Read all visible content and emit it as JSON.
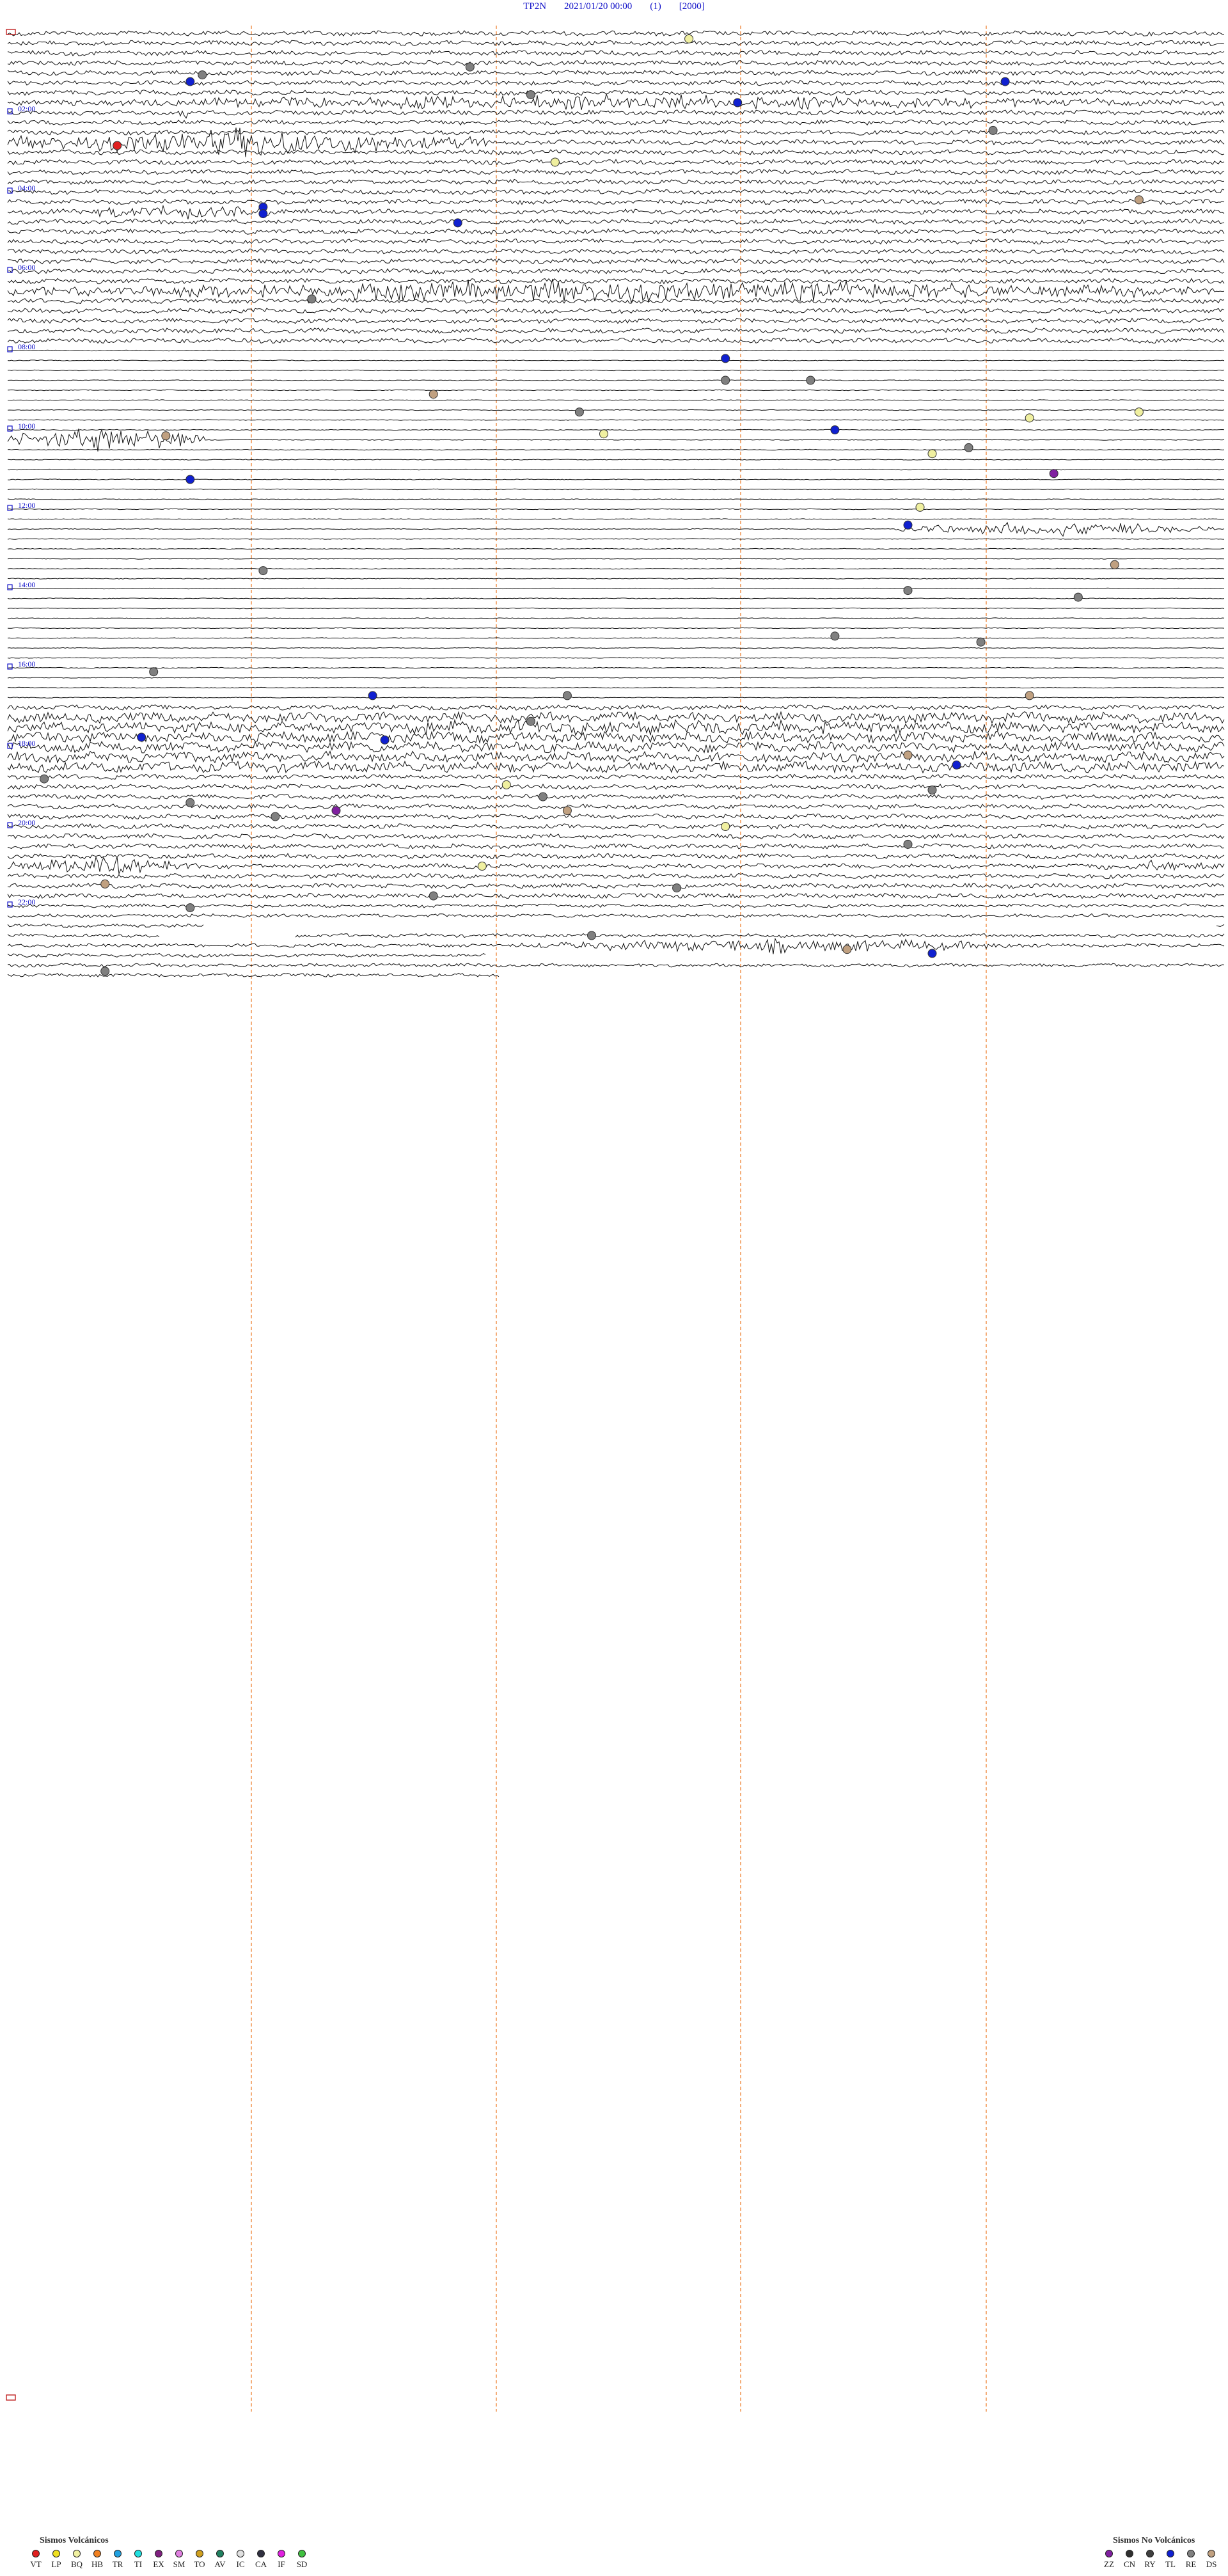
{
  "header": {
    "station": "TP2N",
    "datetime": "2021/01/20 00:00",
    "component": "(1)",
    "gain": "[2000]"
  },
  "hour_labels": [
    "02:00",
    "04:00",
    "06:00",
    "08:00",
    "10:00",
    "12:00",
    "14:00",
    "16:00",
    "18:00",
    "20:00",
    "22:00"
  ],
  "volcanic_legend": {
    "title": "Sismos Volcánicos",
    "items": [
      {
        "code": "VT",
        "color": "#e02020"
      },
      {
        "code": "LP",
        "color": "#f0e020"
      },
      {
        "code": "BQ",
        "color": "#f0f0a0"
      },
      {
        "code": "HB",
        "color": "#f08020"
      },
      {
        "code": "TR",
        "color": "#20a0e0"
      },
      {
        "code": "TI",
        "color": "#20e0e0"
      },
      {
        "code": "EX",
        "color": "#802080"
      },
      {
        "code": "SM",
        "color": "#e080e0"
      },
      {
        "code": "TO",
        "color": "#d0a020"
      },
      {
        "code": "AV",
        "color": "#208060"
      },
      {
        "code": "IC",
        "color": "#e0e0e0"
      },
      {
        "code": "CA",
        "color": "#303040"
      },
      {
        "code": "IF",
        "color": "#e020e0"
      },
      {
        "code": "SD",
        "color": "#40c040"
      }
    ]
  },
  "non_volcanic_legend": {
    "title": "Sismos No Volcánicos",
    "items": [
      {
        "code": "ZZ",
        "color": "#8020a0"
      },
      {
        "code": "CN",
        "color": "#303030"
      },
      {
        "code": "RY",
        "color": "#404040"
      },
      {
        "code": "TL",
        "color": "#1020d0"
      },
      {
        "code": "RE",
        "color": "#808080"
      },
      {
        "code": "DS",
        "color": "#c0a080"
      }
    ]
  },
  "events": [
    {
      "hour": 0.14,
      "frac": 0.56,
      "type": "BQ"
    },
    {
      "hour": 0.85,
      "frac": 0.38,
      "type": "RE"
    },
    {
      "hour": 1.05,
      "frac": 0.16,
      "type": "RE"
    },
    {
      "hour": 1.22,
      "frac": 0.15,
      "type": "TL"
    },
    {
      "hour": 1.22,
      "frac": 0.82,
      "type": "TL"
    },
    {
      "hour": 1.55,
      "frac": 0.43,
      "type": "RE"
    },
    {
      "hour": 1.75,
      "frac": 0.6,
      "type": "TL"
    },
    {
      "hour": 2.45,
      "frac": 0.81,
      "type": "RE"
    },
    {
      "hour": 2.83,
      "frac": 0.09,
      "type": "VT"
    },
    {
      "hour": 3.25,
      "frac": 0.45,
      "type": "BQ"
    },
    {
      "hour": 4.2,
      "frac": 0.93,
      "type": "DS"
    },
    {
      "hour": 4.38,
      "frac": 0.21,
      "type": "TL"
    },
    {
      "hour": 4.55,
      "frac": 0.21,
      "type": "TL"
    },
    {
      "hour": 4.78,
      "frac": 0.37,
      "type": "TL"
    },
    {
      "hour": 6.7,
      "frac": 0.25,
      "type": "RE"
    },
    {
      "hour": 8.2,
      "frac": 0.59,
      "type": "TL"
    },
    {
      "hour": 8.75,
      "frac": 0.59,
      "type": "RE"
    },
    {
      "hour": 8.75,
      "frac": 0.66,
      "type": "RE"
    },
    {
      "hour": 9.1,
      "frac": 0.35,
      "type": "DS"
    },
    {
      "hour": 9.55,
      "frac": 0.47,
      "type": "RE"
    },
    {
      "hour": 9.55,
      "frac": 0.93,
      "type": "BQ"
    },
    {
      "hour": 9.7,
      "frac": 0.84,
      "type": "BQ"
    },
    {
      "hour": 10.0,
      "frac": 0.68,
      "type": "TL"
    },
    {
      "hour": 10.15,
      "frac": 0.13,
      "type": "DS"
    },
    {
      "hour": 10.1,
      "frac": 0.49,
      "type": "BQ"
    },
    {
      "hour": 10.45,
      "frac": 0.79,
      "type": "RE"
    },
    {
      "hour": 10.6,
      "frac": 0.76,
      "type": "BQ"
    },
    {
      "hour": 11.1,
      "frac": 0.86,
      "type": "ZZ"
    },
    {
      "hour": 11.25,
      "frac": 0.15,
      "type": "TL"
    },
    {
      "hour": 11.95,
      "frac": 0.75,
      "type": "BQ"
    },
    {
      "hour": 12.4,
      "frac": 0.74,
      "type": "TL"
    },
    {
      "hour": 13.4,
      "frac": 0.91,
      "type": "DS"
    },
    {
      "hour": 13.55,
      "frac": 0.21,
      "type": "RE"
    },
    {
      "hour": 14.05,
      "frac": 0.74,
      "type": "RE"
    },
    {
      "hour": 14.22,
      "frac": 0.88,
      "type": "RE"
    },
    {
      "hour": 15.2,
      "frac": 0.68,
      "type": "RE"
    },
    {
      "hour": 15.35,
      "frac": 0.8,
      "type": "RE"
    },
    {
      "hour": 16.1,
      "frac": 0.12,
      "type": "RE"
    },
    {
      "hour": 16.7,
      "frac": 0.3,
      "type": "TL"
    },
    {
      "hour": 16.7,
      "frac": 0.46,
      "type": "RE"
    },
    {
      "hour": 16.7,
      "frac": 0.84,
      "type": "DS"
    },
    {
      "hour": 17.35,
      "frac": 0.43,
      "type": "RE"
    },
    {
      "hour": 17.75,
      "frac": 0.11,
      "type": "TL"
    },
    {
      "hour": 17.82,
      "frac": 0.31,
      "type": "TL"
    },
    {
      "hour": 18.2,
      "frac": 0.74,
      "type": "DS"
    },
    {
      "hour": 18.45,
      "frac": 0.78,
      "type": "TL"
    },
    {
      "hour": 18.8,
      "frac": 0.03,
      "type": "RE"
    },
    {
      "hour": 18.95,
      "frac": 0.41,
      "type": "BQ"
    },
    {
      "hour": 19.08,
      "frac": 0.76,
      "type": "RE"
    },
    {
      "hour": 19.25,
      "frac": 0.44,
      "type": "RE"
    },
    {
      "hour": 19.4,
      "frac": 0.15,
      "type": "RE"
    },
    {
      "hour": 19.6,
      "frac": 0.27,
      "type": "ZZ"
    },
    {
      "hour": 19.6,
      "frac": 0.46,
      "type": "DS"
    },
    {
      "hour": 19.75,
      "frac": 0.22,
      "type": "RE"
    },
    {
      "hour": 20.0,
      "frac": 0.59,
      "type": "BQ"
    },
    {
      "hour": 20.45,
      "frac": 0.74,
      "type": "RE"
    },
    {
      "hour": 21.0,
      "frac": 0.39,
      "type": "BQ"
    },
    {
      "hour": 21.45,
      "frac": 0.08,
      "type": "DS"
    },
    {
      "hour": 21.55,
      "frac": 0.55,
      "type": "RE"
    },
    {
      "hour": 21.75,
      "frac": 0.35,
      "type": "RE"
    },
    {
      "hour": 22.05,
      "frac": 0.15,
      "type": "RE"
    },
    {
      "hour": 22.75,
      "frac": 0.48,
      "type": "RE"
    },
    {
      "hour": 23.1,
      "frac": 0.69,
      "type": "DS"
    },
    {
      "hour": 23.2,
      "frac": 0.76,
      "type": "TL"
    },
    {
      "hour": 23.65,
      "frac": 0.08,
      "type": "RE"
    }
  ]
}
